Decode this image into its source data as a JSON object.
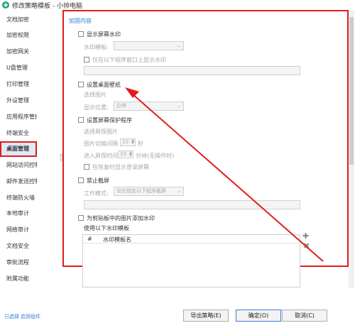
{
  "window": {
    "title": "修改策略模板 - 小帅电脑"
  },
  "sidebar": {
    "items": [
      {
        "label": "文档加密"
      },
      {
        "label": "加密权限"
      },
      {
        "label": "加密网关"
      },
      {
        "label": "U盘管理"
      },
      {
        "label": "打印管理"
      },
      {
        "label": "外设管理"
      },
      {
        "label": "应用程序管控"
      },
      {
        "label": "终端安全"
      },
      {
        "label": "桌面管理"
      },
      {
        "label": "网站访问控制"
      },
      {
        "label": "邮件发送控制"
      },
      {
        "label": "终端防火墙"
      },
      {
        "label": "本地审计"
      },
      {
        "label": "网络审计"
      },
      {
        "label": "文档安全"
      },
      {
        "label": "审批流程"
      },
      {
        "label": "附属功能"
      }
    ],
    "active_index": 8
  },
  "panel": {
    "section_title": "加固内容",
    "watermark": {
      "checkbox_label": "显示屏幕水印",
      "template_label": "水印模板:",
      "only_window_label": "仅在以下程序窗口上显示水印"
    },
    "wallpaper": {
      "checkbox_label": "设置桌面壁纸",
      "choose_label": "选择图片",
      "position_label": "显示位置:",
      "position_value": "拉伸"
    },
    "screensaver": {
      "checkbox_label": "设置屏幕保护程序",
      "choose_label": "选择屏保图片",
      "interval_label": "图片切换间隔",
      "interval_value": "10",
      "interval_unit": "秒",
      "wait_label": "进入屏保时间",
      "wait_value": "10",
      "wait_unit": "分钟(无操作时)",
      "resume_label": "在恢复时显示登录屏幕"
    },
    "screenshot": {
      "checkbox_label": "禁止截屏",
      "mode_label": "工作模式:",
      "mode_value": "仅在指定以下程序截屏"
    },
    "clipboard": {
      "checkbox_label": "为剪贴板中的图片添加水印",
      "template_label": "使用以下水印模板",
      "columns": [
        "#",
        "水印模板名"
      ],
      "add_icon": "plus-icon",
      "remove_icon": "close-icon"
    }
  },
  "footer": {
    "status": "已选择 启用组件",
    "export_label": "导出策略(E)",
    "ok_label": "确定(O)",
    "cancel_label": "取消(C)"
  }
}
